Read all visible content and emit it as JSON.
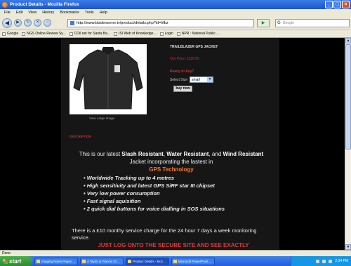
{
  "window": {
    "title": "Product Details - Mozilla Firefox"
  },
  "menu": [
    "File",
    "Edit",
    "View",
    "History",
    "Bookmarks",
    "Tools",
    "Help"
  ],
  "nav": {
    "url": "http://www.bladerunner.tv/product/details.php?id=hfbz",
    "search_placeholder": "Google"
  },
  "bookmarks": [
    "Google",
    "NGS Online Review Sy...",
    "COil.net for Santa Ba...",
    "ISI Web of Knowledge...",
    "Login",
    "NPR : National Public ..."
  ],
  "product": {
    "title": "TRAILBLAZER GPS JACKET",
    "price": "Our Price: £350.00",
    "view_large": "View Large Image",
    "ready": "Ready to buy?",
    "size_label": "Select Size",
    "size_value": "small",
    "buy_label": "buy now"
  },
  "description": {
    "heading": "DESCRIPTION",
    "intro_1": "This is our latest ",
    "intro_b1": "Slash Resistant",
    "intro_2": ", ",
    "intro_b2": "Water Resistant",
    "intro_3": ", and ",
    "intro_b3": "Wind Resistant",
    "intro_4": " Jacket incorporating the lastest in",
    "gps": "GPS Technology",
    "features": [
      "Worldwide Tracking up to 4 metres",
      "High sensitivity and latest GPS SiRF star III chipset",
      "Very low power consumption",
      "Fast signal aquisition",
      "2 quick dial buttons for voice dialling in SOS situations"
    ],
    "service": "There is a £10 monthy service charge for the 24 hour 7 days a week monitoring service.",
    "logon": "JUST LOG ONTO THE SECURE SITE AND SEE EXACTLY"
  },
  "status": {
    "text": "Done"
  },
  "taskbar": {
    "start": "start",
    "tasks": [
      "Imaging Notes Pages ...",
      "A Taylor & Francis Gr...",
      "Product Details - Moz...",
      "Microsoft PowerPoint ..."
    ],
    "clock": "2:34 PM"
  }
}
